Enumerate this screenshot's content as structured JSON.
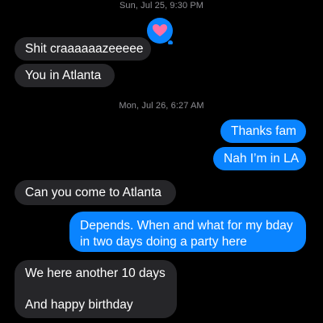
{
  "thread": {
    "timestamps": [
      {
        "text": "Sun, Jul 25, 9:30 PM"
      },
      {
        "text": "Mon, Jul 26, 6:27 AM"
      }
    ],
    "messages": [
      {
        "text": "Shit craaaaaazeeeee",
        "direction": "incoming"
      },
      {
        "text": "You in Atlanta",
        "direction": "incoming"
      },
      {
        "text": "Thanks fam",
        "direction": "outgoing"
      },
      {
        "text": "Nah I’m in LA",
        "direction": "outgoing"
      },
      {
        "text": "Can you come to Atlanta",
        "direction": "incoming"
      },
      {
        "lines": [
          "Depends. When and what for my bday",
          "in two days doing a party here"
        ],
        "direction": "outgoing"
      },
      {
        "lines": [
          "We here another 10 days",
          "",
          "And happy birthday"
        ],
        "direction": "incoming"
      }
    ],
    "reaction": {
      "icon": "heart-icon",
      "target": "Shit craaaaaazeeeee"
    }
  },
  "colors": {
    "background": "#000000",
    "incoming_bubble": "#262629",
    "outgoing_bubble": "#0a84ff",
    "reaction_bubble": "#0a84ff",
    "heart": "#ff6fa3",
    "timestamp_text": "#8e8e93"
  }
}
